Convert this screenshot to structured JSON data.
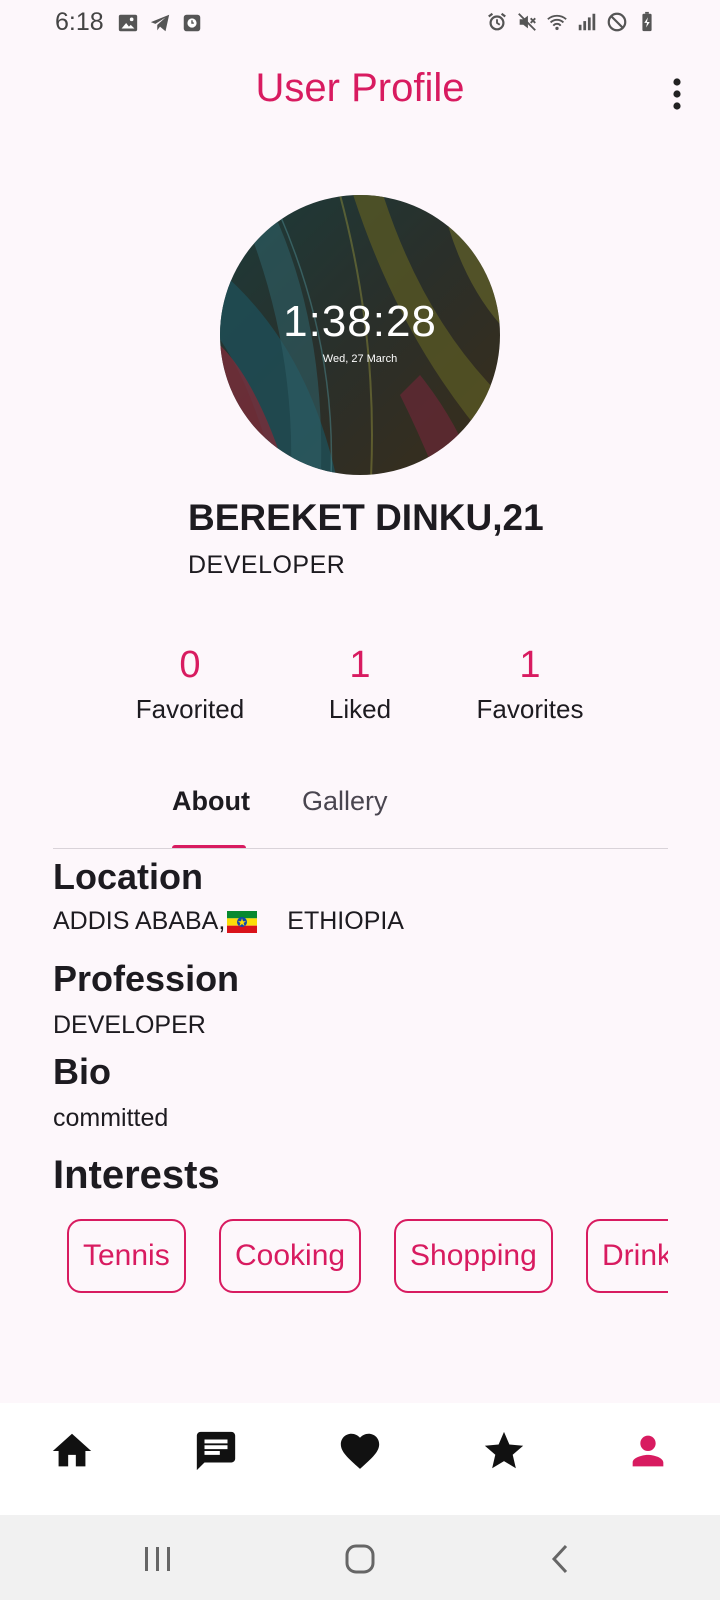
{
  "status_bar": {
    "time": "6:18",
    "left_icons": [
      "gallery-icon",
      "telegram-icon",
      "clock-app-icon"
    ],
    "right_icons": [
      "alarm-icon",
      "mute-icon",
      "wifi-icon",
      "signal-icon",
      "do-not-disturb-icon",
      "battery-charging-icon"
    ]
  },
  "app_bar": {
    "title": "User Profile",
    "menu_icon": "more-vert-icon"
  },
  "avatar": {
    "clock": "1:38:28",
    "date": "Wed, 27 March"
  },
  "profile": {
    "name": "BEREKET DINKU,21",
    "role": "DEVELOPER"
  },
  "stats": [
    {
      "value": "0",
      "label": "Favorited"
    },
    {
      "value": "1",
      "label": "Liked"
    },
    {
      "value": "1",
      "label": "Favorites"
    }
  ],
  "tabs": [
    {
      "label": "About",
      "selected": true
    },
    {
      "label": "Gallery",
      "selected": false
    }
  ],
  "about": {
    "location_title": "Location",
    "location_city": "ADDIS ABABA,",
    "location_country": "ETHIOPIA",
    "profession_title": "Profession",
    "profession_value": "DEVELOPER",
    "bio_title": "Bio",
    "bio_value": "committed",
    "interests_title": "Interests",
    "interests": [
      "Tennis",
      "Cooking",
      "Shopping",
      "Drink"
    ]
  },
  "bottom_nav": {
    "items": [
      {
        "icon": "home-icon",
        "active": false
      },
      {
        "icon": "chat-icon",
        "active": false
      },
      {
        "icon": "heart-icon",
        "active": false
      },
      {
        "icon": "star-icon",
        "active": false
      },
      {
        "icon": "person-icon",
        "active": true
      }
    ]
  },
  "system_nav": [
    "recents-icon",
    "home-circle-icon",
    "back-icon"
  ],
  "colors": {
    "accent": "#d81b60",
    "background": "#fdf7fb",
    "text": "#1d1b20"
  }
}
